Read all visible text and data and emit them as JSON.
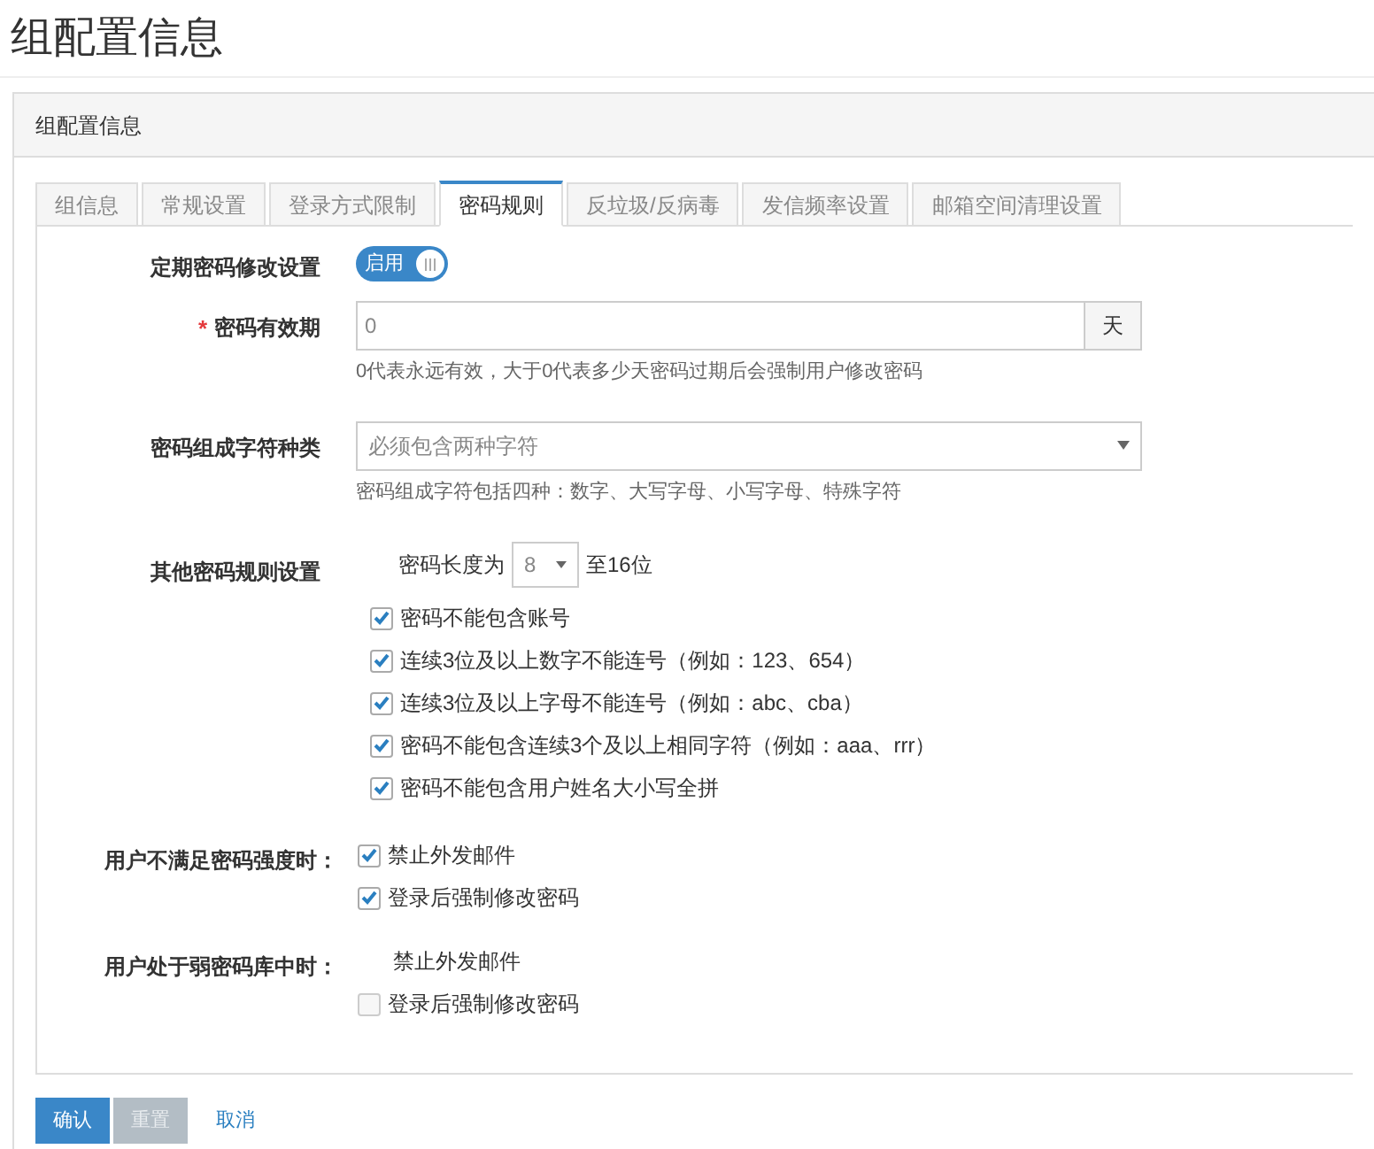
{
  "page_title": "组配置信息",
  "panel": {
    "title": "组配置信息"
  },
  "tabs": [
    {
      "label": "组信息",
      "selected": false
    },
    {
      "label": "常规设置",
      "selected": false
    },
    {
      "label": "登录方式限制",
      "selected": false
    },
    {
      "label": "密码规则",
      "selected": true
    },
    {
      "label": "反垃圾/反病毒",
      "selected": false
    },
    {
      "label": "发信频率设置",
      "selected": false
    },
    {
      "label": "邮箱空间清理设置",
      "selected": false
    }
  ],
  "periodic_change": {
    "label": "定期密码修改设置",
    "toggle_label": "启用",
    "on": true
  },
  "validity": {
    "label": "密码有效期",
    "required_mark": "*",
    "value": "0",
    "unit": "天",
    "help": "0代表永远有效，大于0代表多少天密码过期后会强制用户修改密码"
  },
  "char_types": {
    "label": "密码组成字符种类",
    "value": "必须包含两种字符",
    "help": "密码组成字符包括四种：数字、大写字母、小写字母、特殊字符"
  },
  "other_rules": {
    "label": "其他密码规则设置",
    "length_prefix": "密码长度为",
    "length_min": "8",
    "length_suffix": "至16位",
    "options": [
      {
        "label": "密码不能包含账号",
        "checked": true
      },
      {
        "label": "连续3位及以上数字不能连号（例如：123、654）",
        "checked": true
      },
      {
        "label": "连续3位及以上字母不能连号（例如：abc、cba）",
        "checked": true
      },
      {
        "label": "密码不能包含连续3个及以上相同字符（例如：aaa、rrr）",
        "checked": true
      },
      {
        "label": "密码不能包含用户姓名大小写全拼",
        "checked": true
      }
    ]
  },
  "weak_strength": {
    "label": "用户不满足密码强度时：",
    "options": [
      {
        "kind": "checkbox",
        "label": "禁止外发邮件",
        "checked": true
      },
      {
        "kind": "checkbox",
        "label": "登录后强制修改密码",
        "checked": true
      }
    ]
  },
  "weak_library": {
    "label": "用户处于弱密码库中时：",
    "options": [
      {
        "kind": "plain",
        "label": "禁止外发邮件"
      },
      {
        "kind": "checkbox",
        "label": "登录后强制修改密码",
        "checked": false
      }
    ]
  },
  "buttons": [
    {
      "kind": "primary",
      "label": "确认"
    },
    {
      "kind": "disabled",
      "label": "重置"
    },
    {
      "kind": "link",
      "label": "取消"
    }
  ]
}
